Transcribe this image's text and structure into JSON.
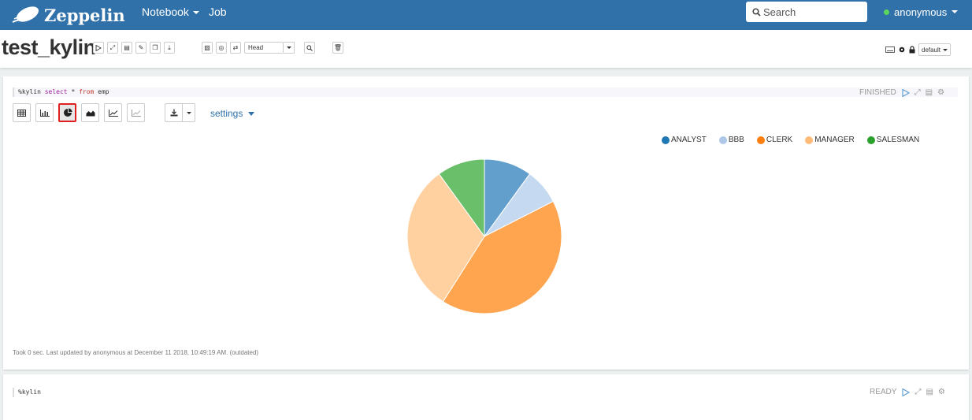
{
  "nav": {
    "brand": "Zeppelin",
    "notebook_label": "Notebook",
    "job_label": "Job",
    "search_placeholder": "Search",
    "user": "anonymous"
  },
  "notebook": {
    "title": "test_kylin",
    "head_label": "Head",
    "interpreter_binding": "default"
  },
  "paragraph1": {
    "code_prefix": "%kylin ",
    "code_select": "select",
    "code_star": " * ",
    "code_from": "from",
    "code_table": " emp",
    "status": "FINISHED",
    "settings_label": "settings",
    "footer": "Took 0 sec. Last updated by anonymous at December 11 2018, 10:49:19 AM. (outdated)"
  },
  "paragraph2": {
    "code": "%kylin",
    "status": "READY"
  },
  "colors": {
    "navbar": "#3071a9",
    "accent": "#5b9bd5",
    "active_highlight": "#e02020"
  },
  "chart_data": {
    "type": "pie",
    "categories": [
      "ANALYST",
      "BBB",
      "CLERK",
      "MANAGER",
      "SALESMAN"
    ],
    "values": [
      10,
      7.5,
      41.5,
      31,
      10
    ],
    "legend_colors": [
      "#1f77b4",
      "#aec7e8",
      "#ff7f0e",
      "#ffbb78",
      "#2ca02c"
    ],
    "slice_colors": [
      "#629fcd",
      "#c5d9f0",
      "#ffa550",
      "#ffd0a0",
      "#6abf6a"
    ],
    "legend_position": "top-right"
  }
}
